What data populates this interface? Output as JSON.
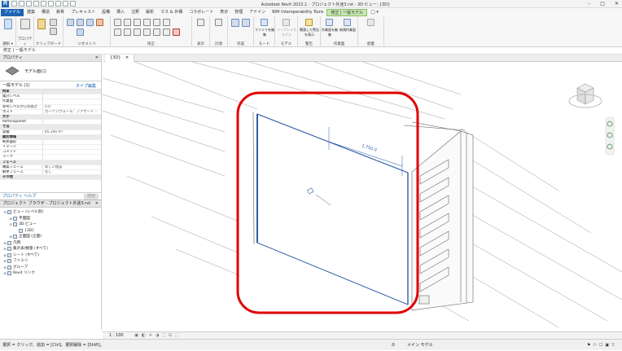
{
  "titlebar": {
    "app_logo": "R",
    "title": "Autodesk Revit 2022.1 - プロジェクト外迷3.rvt - 3D ビュー: {3D}",
    "winbtns": [
      "–",
      "□",
      "✕"
    ]
  },
  "menubar": {
    "tabs": [
      "ファイル",
      "建築",
      "構造",
      "鉄骨",
      "プレキャスト",
      "設備",
      "挿入",
      "注釈",
      "解析",
      "マス & 外構",
      "コラボレート",
      "表示",
      "管理",
      "アドイン",
      "BIM Interoperability Tools",
      "修正 | 一般モデル",
      "◯ ▾"
    ]
  },
  "ribbon": {
    "groups": [
      "",
      "",
      "クリップボード",
      "ジオメトリ",
      "修正",
      "表示",
      "計測",
      "作成",
      "モード",
      "モデル",
      "警告",
      "作業面",
      "配置"
    ],
    "select_label": "選択 ▾",
    "properties_label": "プロパティ",
    "btn_families": "ファミリを編集",
    "btn_inplace": "インプレイス モデル",
    "btn_edit_work": "作業面を編集",
    "btn_new_plane": "新規作業面",
    "btn_show_warn": "関連した警告を表示",
    "btn_dim": "寸法"
  },
  "optbar": {
    "text": "修正 | 一般モデル"
  },
  "properties": {
    "header": "プロパティ",
    "close": "✕",
    "type_name": "モデル面(ロ",
    "filter": "一般モデル (1)",
    "edit_type": "タイプ編集",
    "rows": [
      {
        "k": "拘束",
        "v": "",
        "group": true
      },
      {
        "k": "集計レベル",
        "v": ""
      },
      {
        "k": "作業面",
        "v": ""
      },
      {
        "k": "参考レベルからの高さ",
        "v": "0.0"
      },
      {
        "k": "ホスト",
        "v": "カーテンウォール：ファサード…"
      },
      {
        "k": "文字",
        "v": "",
        "group": true
      },
      {
        "k": "RefUniquedid",
        "v": ""
      },
      {
        "k": "寸法",
        "v": "",
        "group": true
      },
      {
        "k": "容積",
        "v": "85.294 m³"
      },
      {
        "k": "識別情報",
        "v": "",
        "group": true
      },
      {
        "k": "断熱図形",
        "v": ""
      },
      {
        "k": "イメージ",
        "v": ""
      },
      {
        "k": "コメント",
        "v": ""
      },
      {
        "k": "マーク",
        "v": ""
      },
      {
        "k": "フェーズ",
        "v": "",
        "group": true
      },
      {
        "k": "構築フェーズ",
        "v": "新しい建設"
      },
      {
        "k": "解体フェーズ",
        "v": "なし"
      },
      {
        "k": "その他",
        "v": "",
        "group": true
      }
    ],
    "help_link": "プロパティ ヘルプ",
    "apply": "適用"
  },
  "browser": {
    "header": "プロジェクト ブラウザ - プロジェクト外迷3.rvt",
    "close": "✕",
    "items": [
      {
        "indent": 0,
        "tog": "⊟",
        "label": "ビュー (レベル別)"
      },
      {
        "indent": 1,
        "tog": "⊞",
        "label": "平面図"
      },
      {
        "indent": 1,
        "tog": "⊟",
        "label": "3D ビュー"
      },
      {
        "indent": 2,
        "tog": "",
        "label": "{3D}"
      },
      {
        "indent": 1,
        "tog": "⊞",
        "label": "立面図 (立面)"
      },
      {
        "indent": 0,
        "tog": "⊞",
        "label": "凡例"
      },
      {
        "indent": 0,
        "tog": "⊞",
        "label": "集計表/数量 (すべて)"
      },
      {
        "indent": 0,
        "tog": "⊞",
        "label": "シート (すべて)"
      },
      {
        "indent": 0,
        "tog": "⊞",
        "label": "ファミリ"
      },
      {
        "indent": 0,
        "tog": "⊞",
        "label": "グループ"
      },
      {
        "indent": 0,
        "tog": "⊞",
        "label": "Revit リンク"
      }
    ]
  },
  "doc_tab": {
    "label": "{3D}",
    "close": "✕"
  },
  "canvas": {
    "dim_text": "1,750.0"
  },
  "viewbar": {
    "scale": "1 : 100"
  },
  "status": {
    "left": "選択 = クリック、追加 = [Ctrl]、選択解除 = [Shift]。",
    "right_value": ":0",
    "model": "メイン モデル"
  },
  "colors": {
    "accent": "#1b63b5",
    "context_tab": "#c8e6b0",
    "highlight": "#e00000",
    "select_blue": "#2f5ca8"
  }
}
